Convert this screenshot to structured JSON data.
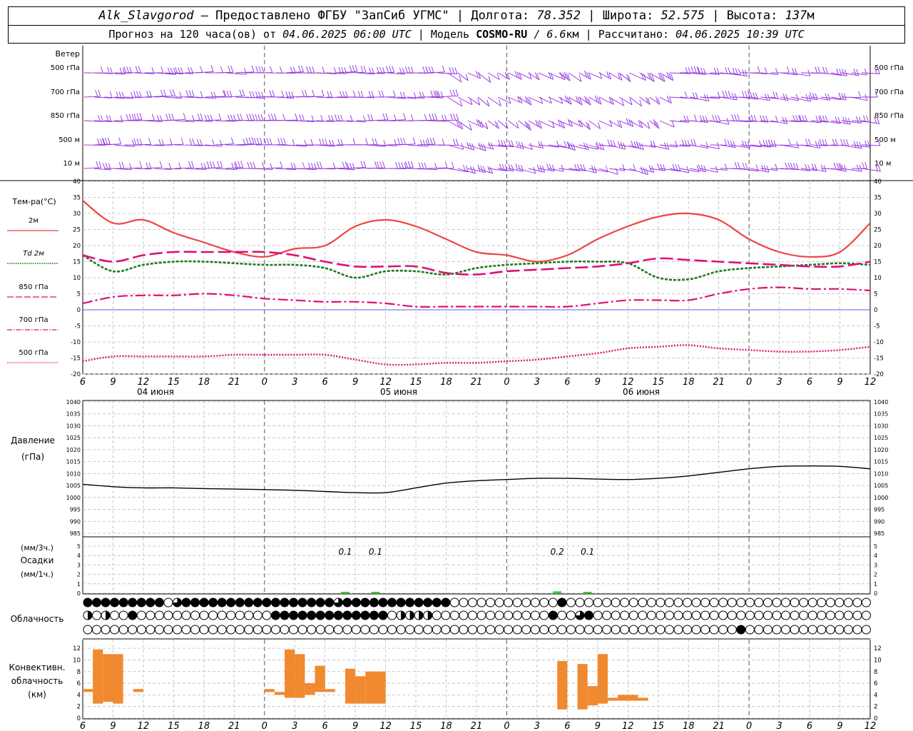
{
  "header": {
    "station": "Alk_Slavgorod",
    "provider": "– Предоставлено ФГБУ \"ЗапСиб УГМС\"",
    "lon_label": "Долгота:",
    "lon": "78.352",
    "lat_label": "Широта:",
    "lat": "52.575",
    "alt_label": "Высота:",
    "alt": "137",
    "alt_unit": "м",
    "forecast_prefix": "Прогноз на 120 часа(ов) от",
    "forecast_time": "04.06.2025 06:00 UTC",
    "model_label": "Модель",
    "model": "COSMO-RU",
    "resolution": "/ 6.6",
    "resolution_unit": "км",
    "calc_label": "Рассчитано:",
    "calc_time": "04.06.2025 10:39 UTC"
  },
  "chart_data": [
    {
      "id": "wind",
      "type": "wind-barbs",
      "title": "Ветер",
      "levels": [
        "500 гПа",
        "700 гПа",
        "850 гПа",
        "500 м",
        "10 м"
      ],
      "colors": [
        "#9b30d9",
        "#8a2be2"
      ]
    },
    {
      "id": "temperature",
      "type": "line",
      "title": "Тем-ра(°C)",
      "ylim": [
        -20,
        40
      ],
      "yticks": [
        -20,
        -15,
        -10,
        -5,
        0,
        5,
        10,
        15,
        20,
        25,
        30,
        35,
        40
      ],
      "x_hours": [
        0,
        3,
        6,
        9,
        12,
        15,
        18,
        21,
        24,
        27,
        30,
        33,
        36,
        39,
        42,
        45,
        48,
        51,
        54,
        57,
        60,
        63,
        66,
        69,
        72,
        75,
        78
      ],
      "series": [
        {
          "name": "2м",
          "color": "#ee4444",
          "dash": "",
          "width": 2.2,
          "values": [
            34,
            27,
            28,
            24,
            21,
            18,
            16.5,
            19,
            20,
            26,
            28,
            26,
            22,
            18,
            17,
            15,
            17,
            22,
            26,
            29,
            30,
            28,
            22,
            18,
            16.5,
            18,
            27
          ]
        },
        {
          "name": "Td 2м",
          "color": "#1e7a1e",
          "dash": "4,2",
          "width": 2.6,
          "values": [
            17,
            12,
            14,
            15,
            15,
            14.5,
            14,
            14,
            13,
            10,
            12,
            12,
            11,
            13,
            14,
            14.5,
            15,
            15,
            14.5,
            10,
            9.5,
            12,
            13,
            13.5,
            14,
            14.5,
            14
          ]
        },
        {
          "name": "850 гПа",
          "color": "#dd1077",
          "dash": "18,6",
          "width": 2.6,
          "values": [
            17,
            15,
            17,
            18,
            18,
            18,
            18,
            17,
            15,
            13.5,
            13.5,
            13.5,
            11.5,
            11,
            12,
            12.5,
            13,
            13.5,
            14.5,
            16,
            15.5,
            15,
            14.5,
            14,
            13.5,
            13.5,
            15
          ]
        },
        {
          "name": "700 гПа",
          "color": "#dd1077",
          "dash": "14,4,3,4",
          "width": 2.2,
          "values": [
            2,
            4,
            4.5,
            4.5,
            5,
            4.5,
            3.5,
            3,
            2.5,
            2.5,
            2,
            1,
            1,
            1,
            1,
            1,
            1,
            2,
            3,
            3,
            3,
            5,
            6.5,
            7,
            6.5,
            6.5,
            6
          ]
        },
        {
          "name": "500 гПа",
          "color": "#dd1077",
          "dash": "2,2",
          "width": 2.4,
          "values": [
            -16,
            -14.5,
            -14.5,
            -14.5,
            -14.5,
            -14,
            -14,
            -14,
            -14,
            -15.5,
            -17,
            -17,
            -16.5,
            -16.5,
            -16,
            -15.5,
            -14.5,
            -13.5,
            -12,
            -11.5,
            -11,
            -12,
            -12.5,
            -13,
            -13,
            -12.5,
            -11.5
          ]
        }
      ],
      "zero_line_color": "#3333dd"
    },
    {
      "id": "pressure",
      "type": "line",
      "title": "Давление",
      "unit": "(гПа)",
      "ylim": [
        985,
        1040
      ],
      "yticks": [
        985,
        990,
        995,
        1000,
        1005,
        1010,
        1015,
        1020,
        1025,
        1030,
        1035,
        1040
      ],
      "x_hours": [
        0,
        3,
        6,
        9,
        12,
        15,
        18,
        21,
        24,
        27,
        30,
        33,
        36,
        39,
        42,
        45,
        48,
        51,
        54,
        57,
        60,
        63,
        66,
        69,
        72,
        75,
        78
      ],
      "series": [
        {
          "name": "",
          "color": "#000000",
          "values": [
            1005.5,
            1004.5,
            1004,
            1004,
            1003.7,
            1003.5,
            1003.3,
            1003,
            1002.5,
            1002,
            1002,
            1004,
            1006,
            1007,
            1007.5,
            1008,
            1008,
            1007.7,
            1007.5,
            1008,
            1009,
            1010.5,
            1012,
            1013,
            1013.2,
            1013,
            1012
          ]
        }
      ]
    },
    {
      "id": "precip",
      "type": "bar",
      "title": "Осадки",
      "unit_top": "(мм/3ч.)",
      "unit_bottom": "(мм/1ч.)",
      "ylim": [
        0,
        5
      ],
      "yticks": [
        0,
        1,
        2,
        3,
        4,
        5
      ],
      "bars": [
        {
          "hour": 26,
          "value": 0.1,
          "label": "0.1"
        },
        {
          "hour": 29,
          "value": 0.1,
          "label": "0.1"
        },
        {
          "hour": 47,
          "value": 0.2,
          "label": "0.2"
        },
        {
          "hour": 50,
          "value": 0.1,
          "label": "0.1"
        }
      ],
      "color": "#22dd22"
    },
    {
      "id": "cloud",
      "type": "symbol-rows",
      "title": "Облачность",
      "rows": [
        "44444444403444444444444444443444444444444000000000000400000000000000000000000000000000000",
        "20200400000000000000044444444444440222200000000000004003400000000000000000000000000000000",
        "00000000000000000000000000000000000000000000000000000000000000000000000004000000000000000"
      ]
    },
    {
      "id": "convective",
      "type": "range-bar",
      "title": "Конвективн.",
      "subtitle": "облачность",
      "unit": "(км)",
      "ylim": [
        0,
        13
      ],
      "yticks": [
        0,
        2,
        4,
        6,
        8,
        10,
        12
      ],
      "color": "#f0892f",
      "bars": [
        {
          "hour": 0,
          "base": 4.5,
          "top": 5.0
        },
        {
          "hour": 1,
          "base": 2.5,
          "top": 11.8
        },
        {
          "hour": 2,
          "base": 2.8,
          "top": 11.0
        },
        {
          "hour": 3,
          "base": 2.5,
          "top": 11.0
        },
        {
          "hour": 5,
          "base": 4.5,
          "top": 5.0
        },
        {
          "hour": 18,
          "base": 4.5,
          "top": 5.0
        },
        {
          "hour": 19,
          "base": 4.0,
          "top": 4.5
        },
        {
          "hour": 20,
          "base": 3.5,
          "top": 11.8
        },
        {
          "hour": 21,
          "base": 3.5,
          "top": 11.0
        },
        {
          "hour": 22,
          "base": 4.0,
          "top": 6.0
        },
        {
          "hour": 23,
          "base": 4.5,
          "top": 9.0
        },
        {
          "hour": 24,
          "base": 4.5,
          "top": 5.0
        },
        {
          "hour": 26,
          "base": 2.5,
          "top": 8.5
        },
        {
          "hour": 27,
          "base": 2.5,
          "top": 7.2
        },
        {
          "hour": 28,
          "base": 2.5,
          "top": 8.0
        },
        {
          "hour": 29,
          "base": 2.5,
          "top": 8.0
        },
        {
          "hour": 47,
          "base": 1.5,
          "top": 9.8
        },
        {
          "hour": 49,
          "base": 1.5,
          "top": 9.3
        },
        {
          "hour": 50,
          "base": 2.2,
          "top": 5.5
        },
        {
          "hour": 51,
          "base": 2.5,
          "top": 11.0
        },
        {
          "hour": 52,
          "base": 3.0,
          "top": 3.5
        },
        {
          "hour": 53,
          "base": 3.0,
          "top": 4.0
        },
        {
          "hour": 54,
          "base": 3.0,
          "top": 4.0
        },
        {
          "hour": 55,
          "base": 3.0,
          "top": 3.5
        }
      ]
    }
  ],
  "time_axis": {
    "tick_labels": [
      "6",
      "9",
      "12",
      "15",
      "18",
      "21",
      "0",
      "3",
      "6",
      "9",
      "12",
      "15",
      "18",
      "21",
      "0",
      "3",
      "6",
      "9",
      "12",
      "15",
      "18",
      "21",
      "0",
      "3",
      "6",
      "9",
      "12"
    ],
    "date_labels": [
      "04 июня",
      "05 июня",
      "06 июня"
    ]
  }
}
